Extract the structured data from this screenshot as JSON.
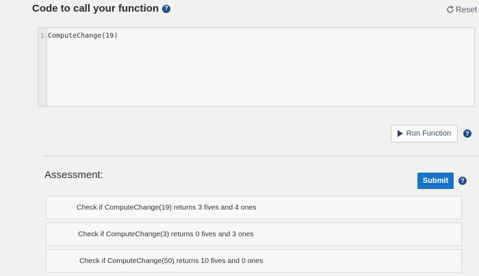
{
  "header": {
    "title": "Code to call your function",
    "help_icon": "help-circle-icon"
  },
  "reset": {
    "label": "Reset",
    "icon": "reset-arrow-icon"
  },
  "editor": {
    "lines": [
      {
        "number": "1",
        "code": "ComputeChange(19)"
      }
    ]
  },
  "run": {
    "label": "Run Function",
    "icon": "play-icon"
  },
  "assessment": {
    "title": "Assessment:",
    "submit_label": "Submit",
    "tests": [
      {
        "text": "Check if ComputeChange(19) returns 3 fives and 4 ones"
      },
      {
        "text": "Check if ComputeChange(3) returns 0 fives and 3 ones"
      },
      {
        "text": "Check if ComputeChange(50) returns 10 fives and 0 ones"
      }
    ]
  },
  "colors": {
    "accent": "#1b73c9",
    "help": "#1f4d8a"
  }
}
